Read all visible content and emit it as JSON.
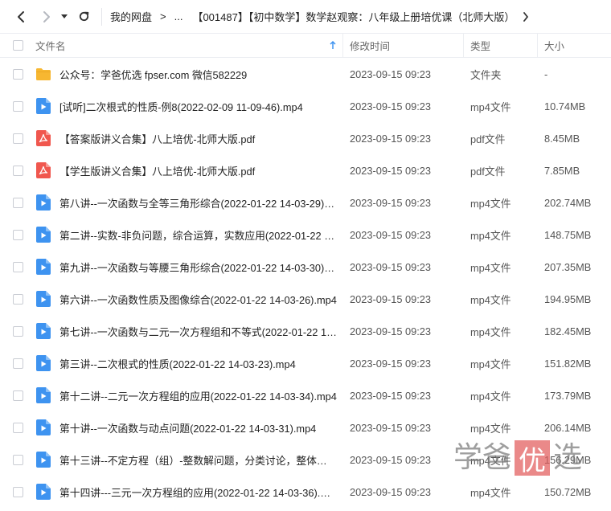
{
  "toolbar": {
    "breadcrumbs": [
      "我的网盘",
      "...",
      "【001487】【初中数学】数学赵观察：八年级上册培优课（北师大版）"
    ],
    "separator": ">"
  },
  "columns": {
    "name": "文件名",
    "modified": "修改时间",
    "type": "类型",
    "size": "大小"
  },
  "files": [
    {
      "icon": "folder-icon",
      "name": "公众号：学爸优选 fpser.com 微信582229",
      "modified": "2023-09-15 09:23",
      "type": "文件夹",
      "size": "-"
    },
    {
      "icon": "video-file-icon",
      "name": "[试听]二次根式的性质-例8(2022-02-09 11-09-46).mp4",
      "modified": "2023-09-15 09:23",
      "type": "mp4文件",
      "size": "10.74MB"
    },
    {
      "icon": "pdf-file-icon",
      "name": "【答案版讲义合集】八上培优-北师大版.pdf",
      "modified": "2023-09-15 09:23",
      "type": "pdf文件",
      "size": "8.45MB"
    },
    {
      "icon": "pdf-file-icon",
      "name": "【学生版讲义合集】八上培优-北师大版.pdf",
      "modified": "2023-09-15 09:23",
      "type": "pdf文件",
      "size": "7.85MB"
    },
    {
      "icon": "video-file-icon",
      "name": "第八讲--一次函数与全等三角形综合(2022-01-22 14-03-29).mp4",
      "modified": "2023-09-15 09:23",
      "type": "mp4文件",
      "size": "202.74MB"
    },
    {
      "icon": "video-file-icon",
      "name": "第二讲--实数-非负问题，综合运算，实数应用(2022-01-22 14-...",
      "modified": "2023-09-15 09:23",
      "type": "mp4文件",
      "size": "148.75MB"
    },
    {
      "icon": "video-file-icon",
      "name": "第九讲--一次函数与等腰三角形综合(2022-01-22 14-03-30).mp4",
      "modified": "2023-09-15 09:23",
      "type": "mp4文件",
      "size": "207.35MB"
    },
    {
      "icon": "video-file-icon",
      "name": "第六讲--一次函数性质及图像综合(2022-01-22 14-03-26).mp4",
      "modified": "2023-09-15 09:23",
      "type": "mp4文件",
      "size": "194.95MB"
    },
    {
      "icon": "video-file-icon",
      "name": "第七讲--一次函数与二元一次方程组和不等式(2022-01-22 14-0...",
      "modified": "2023-09-15 09:23",
      "type": "mp4文件",
      "size": "182.45MB"
    },
    {
      "icon": "video-file-icon",
      "name": "第三讲--二次根式的性质(2022-01-22 14-03-23).mp4",
      "modified": "2023-09-15 09:23",
      "type": "mp4文件",
      "size": "151.82MB"
    },
    {
      "icon": "video-file-icon",
      "name": "第十二讲--二元一次方程组的应用(2022-01-22 14-03-34).mp4",
      "modified": "2023-09-15 09:23",
      "type": "mp4文件",
      "size": "173.79MB"
    },
    {
      "icon": "video-file-icon",
      "name": "第十讲--一次函数与动点问题(2022-01-22 14-03-31).mp4",
      "modified": "2023-09-15 09:23",
      "type": "mp4文件",
      "size": "206.14MB"
    },
    {
      "icon": "video-file-icon",
      "name": "第十三讲--不定方程（组）-整数解问题，分类讨论，整体思想(2...",
      "modified": "2023-09-15 09:23",
      "type": "mp4文件",
      "size": "156.29MB"
    },
    {
      "icon": "video-file-icon",
      "name": "第十四讲---三元一次方程组的应用(2022-01-22 14-03-36).mp4",
      "modified": "2023-09-15 09:23",
      "type": "mp4文件",
      "size": "150.72MB"
    }
  ],
  "watermark": [
    "学",
    "爸",
    "优",
    "选"
  ],
  "colors": {
    "folder": "#F7B731",
    "video": "#3E93F0",
    "pdf": "#F0574E",
    "sort_arrow": "#3E93F0"
  }
}
